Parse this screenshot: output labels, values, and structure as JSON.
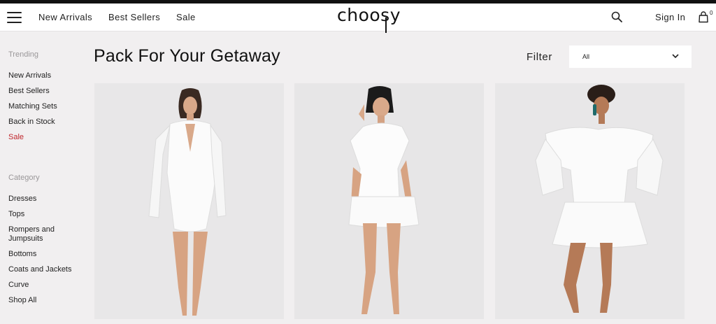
{
  "brand": {
    "logo": "choosy"
  },
  "header": {
    "nav": [
      "New Arrivals",
      "Best Sellers",
      "Sale"
    ],
    "signin": "Sign In",
    "bag_count": "0"
  },
  "sidebar": {
    "trending_heading": "Trending",
    "trending": [
      "New Arrivals",
      "Best Sellers",
      "Matching Sets",
      "Back in Stock",
      "Sale"
    ],
    "category_heading": "Category",
    "categories": [
      "Dresses",
      "Tops",
      "Rompers and Jumpsuits",
      "Bottoms",
      "Coats and Jackets",
      "Curve",
      "Shop All"
    ]
  },
  "main": {
    "title": "Pack For Your Getaway",
    "filter_label": "Filter",
    "filter_value": "All"
  },
  "colors": {
    "sale": "#c0282e",
    "background": "#f1eff0",
    "topbar": "#111111"
  },
  "icons": [
    "hamburger-menu-icon",
    "search-icon",
    "shopping-bag-icon",
    "chevron-down-icon"
  ]
}
